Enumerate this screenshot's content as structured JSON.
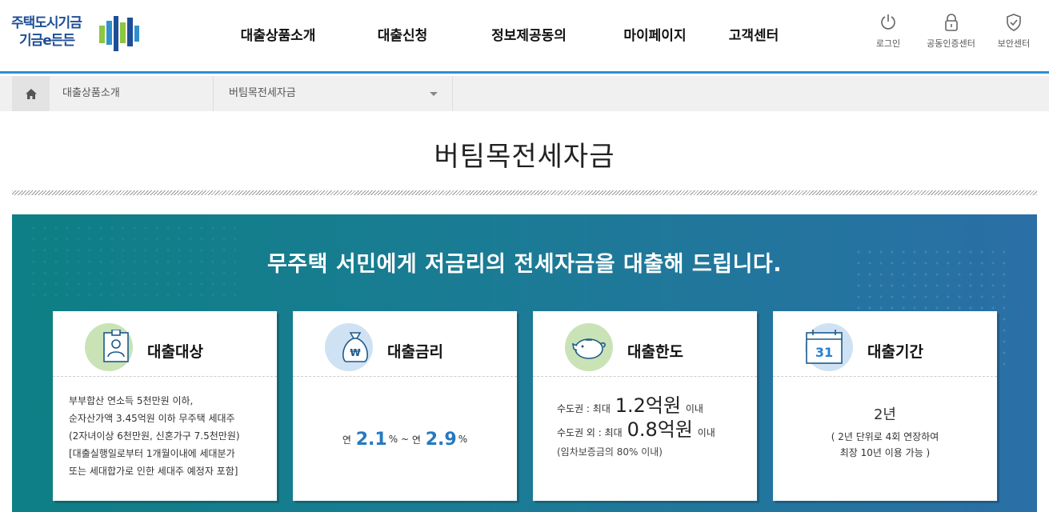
{
  "header": {
    "logo": {
      "line1": "주택도시기금",
      "line2": "기금e든든"
    },
    "nav": [
      "대출상품소개",
      "대출신청",
      "정보제공동의",
      "마이페이지",
      "고객센터"
    ],
    "utils": [
      {
        "label": "로그인",
        "icon": "power-icon"
      },
      {
        "label": "공동인증센터",
        "icon": "lock-icon"
      },
      {
        "label": "보안센터",
        "icon": "shield-icon"
      }
    ],
    "accent": "#2f8fd1"
  },
  "breadcrumb": {
    "level1": "대출상품소개",
    "level2": "버팀목전세자금"
  },
  "page_title": "버팀목전세자금",
  "banner": {
    "headline": "무주택 서민에게 저금리의 전세자금을 대출해 드립니다.",
    "colors": [
      "#0e7f85",
      "#2a6fa6"
    ]
  },
  "cards": {
    "target": {
      "title": "대출대상",
      "lines": [
        "부부합산 연소득 5천만원 이하,",
        "순자산가액 3.45억원 이하 무주택 세대주",
        "(2자녀이상 6천만원, 신혼가구 7.5천만원)",
        "[대출실행일로부터 1개월이내에 세대분가",
        "또는 세대합가로 인한 세대주 예정자 포함]"
      ]
    },
    "rate": {
      "title": "대출금리",
      "prefix": "연",
      "min": "2.1",
      "pct1": "%",
      "tilde": "~",
      "prefix2": "연",
      "max": "2.9",
      "pct2": "%"
    },
    "limit": {
      "title": "대출한도",
      "row1_label": "수도권 : 최대",
      "row1_value": "1.2억원",
      "row1_suffix": "이내",
      "row2_label": "수도권 외 : 최대",
      "row2_value": "0.8억원",
      "row2_suffix": "이내",
      "note": "(임차보증금의 80% 이내)"
    },
    "period": {
      "title": "대출기간",
      "calendar_day": "31",
      "years": "2년",
      "note1": "( 2년 단위로 4회 연장하여",
      "note2": "최장 10년 이용 가능 )"
    }
  }
}
